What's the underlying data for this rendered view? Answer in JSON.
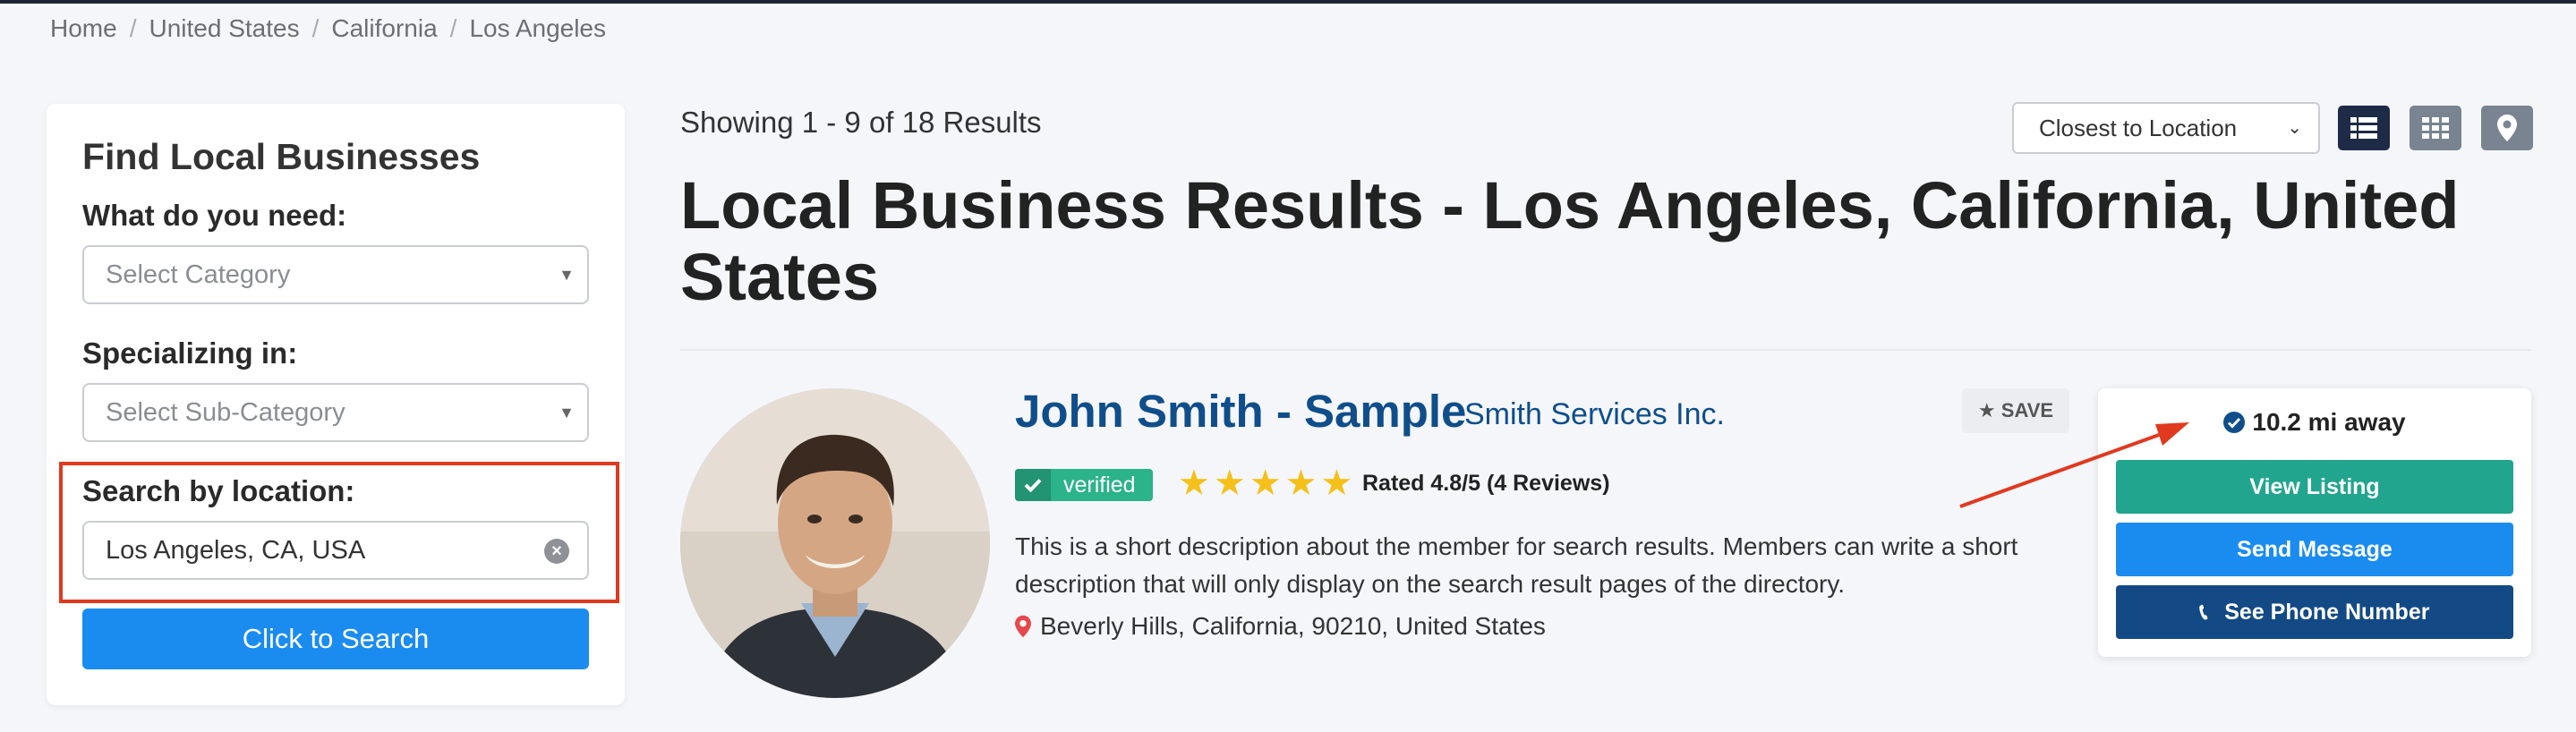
{
  "breadcrumb": [
    "Home",
    "United States",
    "California",
    "Los Angeles"
  ],
  "breadcrumb_separator": "/",
  "sidebar": {
    "title": "Find Local Businesses",
    "need_label": "What do you need:",
    "category_placeholder": "Select Category",
    "specializing_label": "Specializing in:",
    "subcategory_placeholder": "Select Sub-Category",
    "location_label": "Search by location:",
    "location_value": "Los Angeles, CA, USA",
    "search_button": "Click to Search"
  },
  "results": {
    "showing": "Showing 1 - 9 of 18 Results",
    "sort_selected": "Closest to Location",
    "title": "Local Business Results - Los Angeles, California, United States"
  },
  "listing": {
    "name": "John Smith - Sample",
    "company": "Smith Services Inc.",
    "save_label": "SAVE",
    "verified_label": "verified",
    "rating_stars": 5,
    "rating_text": "Rated 4.8/5 (4 Reviews)",
    "description": "This is a short description about the member for search results. Members can write a short description that will only display on the search result pages of the directory.",
    "location": "Beverly Hills, California, 90210, United States",
    "distance": "10.2 mi away",
    "view_button": "View Listing",
    "message_button": "Send Message",
    "phone_button": "See Phone Number"
  },
  "icons": {
    "view_list": "list-view-icon",
    "view_grid": "grid-view-icon",
    "view_map": "map-pin-icon",
    "save": "star-icon",
    "verified": "check-icon",
    "distance": "check-circle-icon",
    "phone": "phone-icon",
    "location": "map-marker-icon"
  },
  "colors": {
    "accent_blue": "#1a8cf0",
    "teal": "#21a58e",
    "navy": "#134a85",
    "name_blue": "#0f4e8a",
    "highlight_red": "#e0391f",
    "star_yellow": "#f5c01a"
  }
}
